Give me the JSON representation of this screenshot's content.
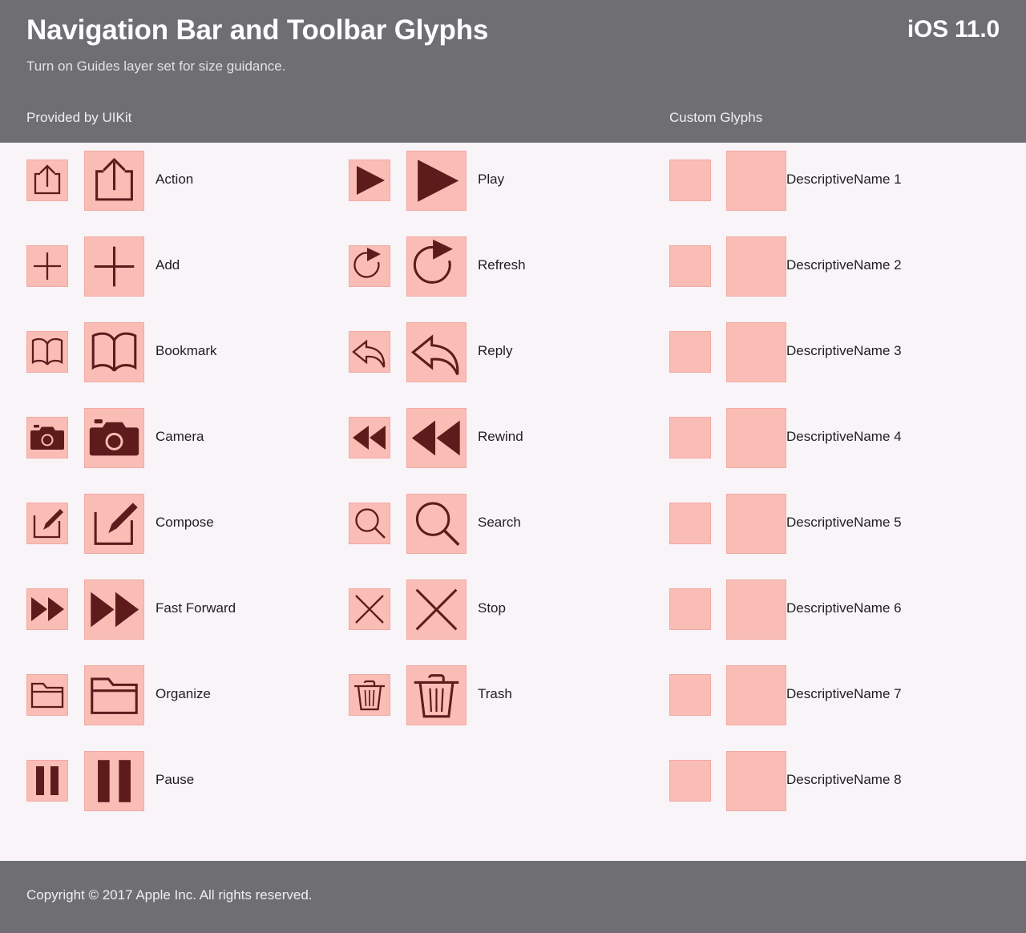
{
  "header": {
    "title": "Navigation Bar and Toolbar Glyphs",
    "version": "iOS 11.0",
    "subtitle": "Turn on Guides layer set for size guidance.",
    "section_left": "Provided by UIKit",
    "section_right": "Custom Glyphs",
    "background_color": "#6f6e72",
    "text_color": "#ffffff"
  },
  "footer": {
    "copyright": "Copyright © 2017 Apple Inc. All rights reserved.",
    "background_color": "#6f6e72"
  },
  "theme": {
    "page_background": "#f8f4f7",
    "glyph_box_fill": "#f9bdb6",
    "glyph_box_border": "#f2a9a2",
    "glyph_stroke": "#5e1b1b",
    "label_color": "#1f1f22"
  },
  "columns": [
    {
      "name": "uikit-column-1",
      "glyphs": [
        {
          "icon": "action-icon",
          "label": "Action"
        },
        {
          "icon": "add-icon",
          "label": "Add"
        },
        {
          "icon": "bookmark-icon",
          "label": "Bookmark"
        },
        {
          "icon": "camera-icon",
          "label": "Camera"
        },
        {
          "icon": "compose-icon",
          "label": "Compose"
        },
        {
          "icon": "fast-forward-icon",
          "label": "Fast Forward"
        },
        {
          "icon": "organize-icon",
          "label": "Organize"
        },
        {
          "icon": "pause-icon",
          "label": "Pause"
        }
      ]
    },
    {
      "name": "uikit-column-2",
      "glyphs": [
        {
          "icon": "play-icon",
          "label": "Play"
        },
        {
          "icon": "refresh-icon",
          "label": "Refresh"
        },
        {
          "icon": "reply-icon",
          "label": "Reply"
        },
        {
          "icon": "rewind-icon",
          "label": "Rewind"
        },
        {
          "icon": "search-icon",
          "label": "Search"
        },
        {
          "icon": "stop-icon",
          "label": "Stop"
        },
        {
          "icon": "trash-icon",
          "label": "Trash"
        }
      ]
    },
    {
      "name": "custom-glyphs-column",
      "glyphs": [
        {
          "icon": "empty-glyph-icon",
          "label": "DescriptiveName 1"
        },
        {
          "icon": "empty-glyph-icon",
          "label": "DescriptiveName 2"
        },
        {
          "icon": "empty-glyph-icon",
          "label": "DescriptiveName 3"
        },
        {
          "icon": "empty-glyph-icon",
          "label": "DescriptiveName 4"
        },
        {
          "icon": "empty-glyph-icon",
          "label": "DescriptiveName 5"
        },
        {
          "icon": "empty-glyph-icon",
          "label": "DescriptiveName 6"
        },
        {
          "icon": "empty-glyph-icon",
          "label": "DescriptiveName 7"
        },
        {
          "icon": "empty-glyph-icon",
          "label": "DescriptiveName 8"
        }
      ]
    }
  ]
}
